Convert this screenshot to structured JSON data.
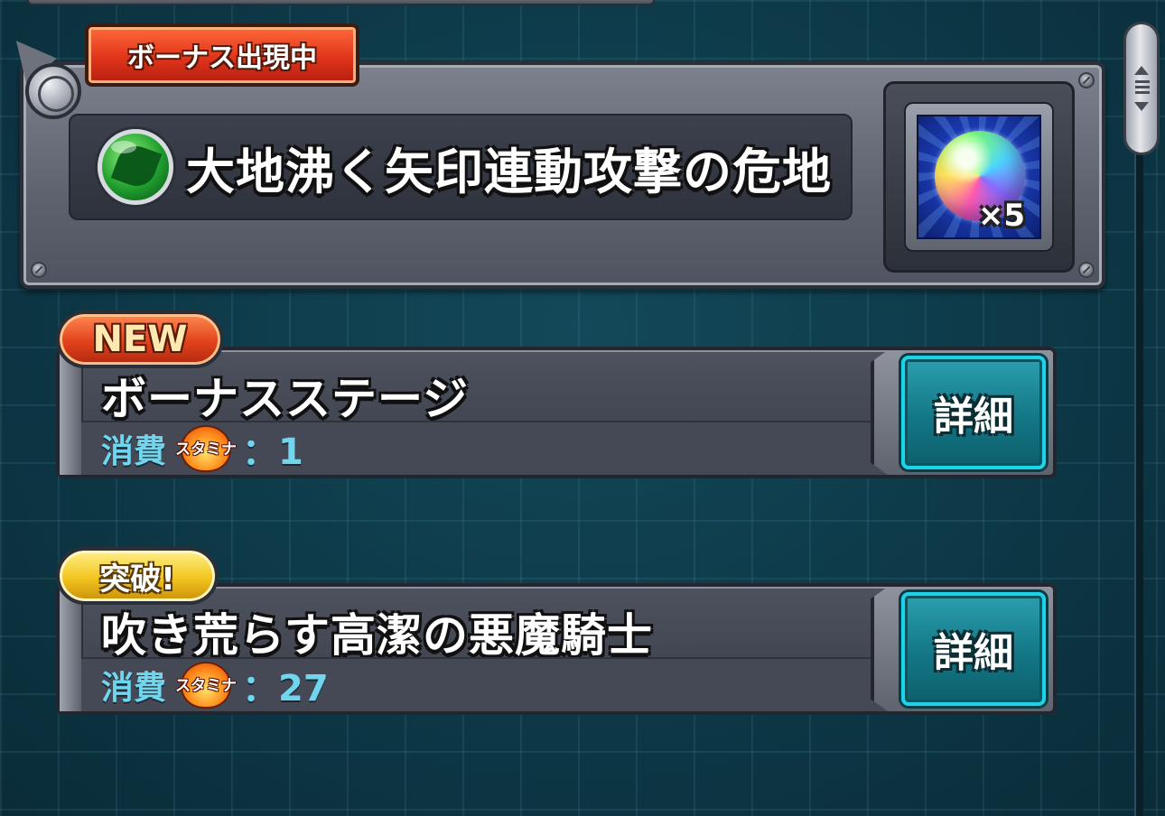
{
  "quest": {
    "bonus_badge": "ボーナス出現中",
    "element": "wood",
    "element_icon": "leaf-element-icon",
    "title": "大地沸く矢印連動攻撃の危地",
    "reward": {
      "icon": "rainbow-orb-icon",
      "count": "×5"
    }
  },
  "stages": [
    {
      "tag": "NEW",
      "tag_color": "#e1431c",
      "name": "ボーナスステージ",
      "cost_label": "消費",
      "stamina_icon_text": "スタミナ",
      "cost_value": "：1",
      "detail_label": "詳細"
    },
    {
      "tag": "突破!",
      "tag_color": "#f2c51e",
      "name": "吹き荒らす高潔の悪魔騎士",
      "cost_label": "消費",
      "stamina_icon_text": "スタミナ",
      "cost_value": "：27",
      "detail_label": "詳細"
    }
  ],
  "colors": {
    "background": "#0f3a48",
    "accent_cyan": "#1dd3e8",
    "cost_text": "#6fd6ee"
  }
}
